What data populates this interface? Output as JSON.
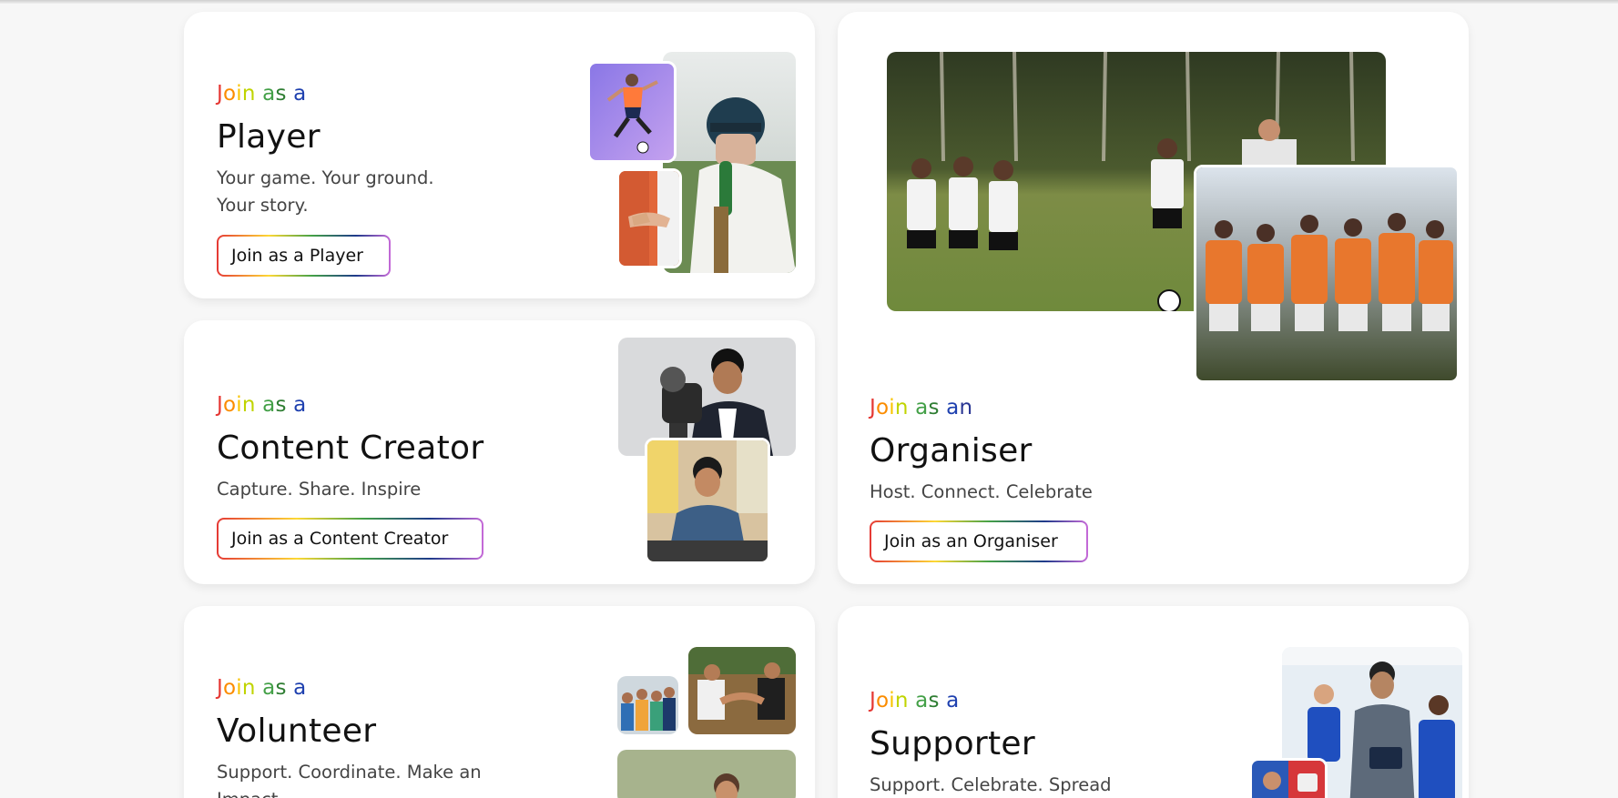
{
  "colors": {
    "eyebrow_letters": [
      "#e53935",
      "#fb8c00",
      "#f9c400",
      "#c0d400",
      "#43a047",
      "#2e7d32",
      "#1e40af",
      "#283593"
    ]
  },
  "cards": {
    "player": {
      "eyebrow": "Join as a",
      "title": "Player",
      "desc_line1": "Your game. Your ground.",
      "desc_line2": "Your story.",
      "button": "Join as a Player"
    },
    "creator": {
      "eyebrow": "Join as a",
      "title": "Content Creator",
      "desc_line1": "Capture. Share. Inspire",
      "button": "Join as a Content Creator"
    },
    "organiser": {
      "eyebrow": "Join as an",
      "title": "Organiser",
      "desc_line1": "Host. Connect. Celebrate",
      "button": "Join as an Organiser"
    },
    "volunteer": {
      "eyebrow": "Join as a",
      "title": "Volunteer",
      "desc_line1": "Support. Coordinate. Make an",
      "desc_line2": "Impact"
    },
    "supporter": {
      "eyebrow": "Join as a",
      "title": "Supporter",
      "desc_line1": "Support. Celebrate. Spread"
    }
  },
  "photos": {
    "player_kick": "footballer-kicking-photo",
    "player_handshake": "handshake-photo",
    "player_cricket": "cricket-batsman-photo",
    "creator_camera": "creator-with-camera-photo",
    "creator_desk": "creator-at-desk-photo",
    "organiser_field": "kids-football-field-photo",
    "organiser_team": "team-huddle-photo",
    "volunteer_group": "volunteer-group-photo",
    "volunteer_hands": "volunteer-hands-photo",
    "volunteer_crowd": "volunteer-crowd-photo",
    "supporter_coach": "coach-with-kids-photo",
    "supporter_small": "supporter-small-photo"
  }
}
